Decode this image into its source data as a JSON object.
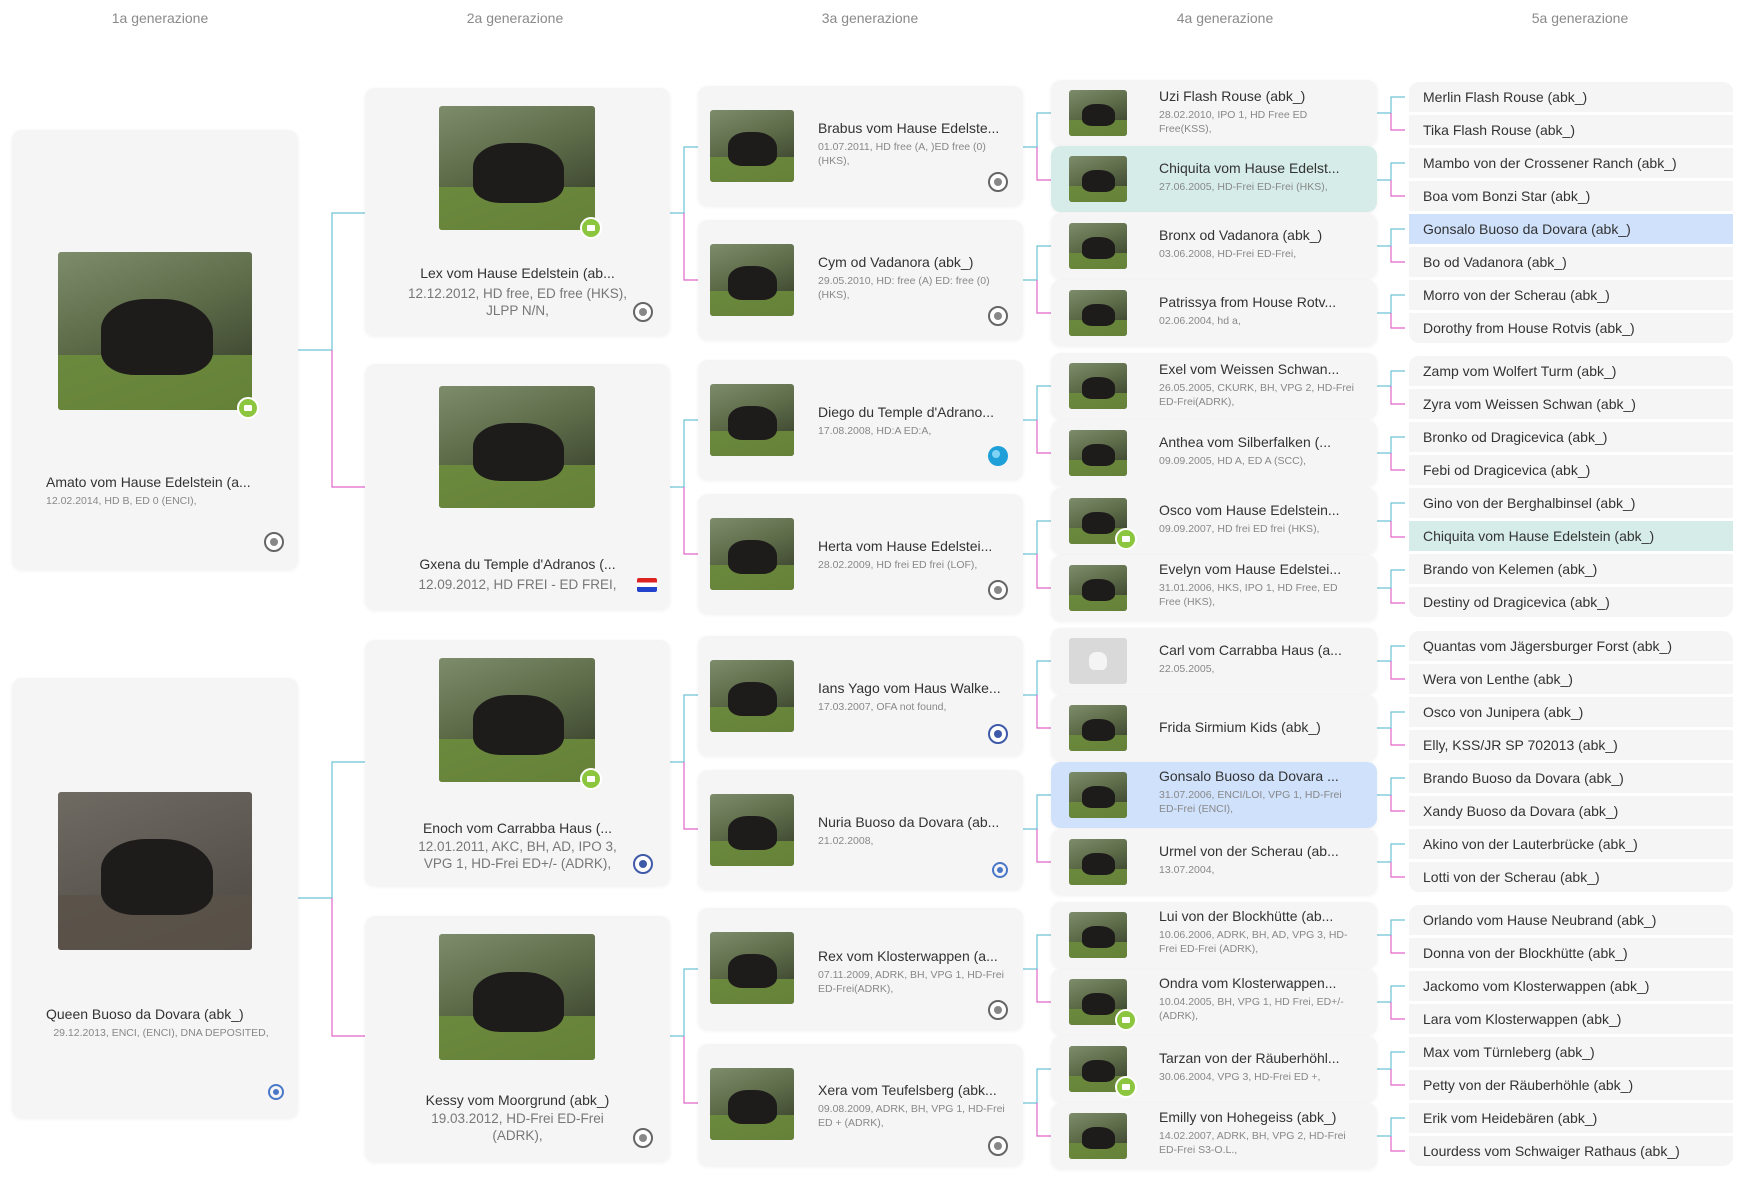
{
  "generations": [
    "1a generazione",
    "2a generazione",
    "3a generazione",
    "4a generazione",
    "5a generazione"
  ],
  "gen1": [
    {
      "name": "Amato vom Hause Edelstein (a...",
      "info": "12.02.2014, HD B, ED 0 (ENCI),"
    },
    {
      "name": "Queen Buoso da Dovara (abk_)",
      "info": "29.12.2013, ENCI, (ENCI), DNA DEPOSITED,"
    }
  ],
  "gen2": [
    {
      "name": "Lex vom Hause Edelstein (ab...",
      "info": "12.12.2012, HD free, ED free (HKS), JLPP N/N,"
    },
    {
      "name": "Gxena du Temple d'Adranos (...",
      "info": "12.09.2012, HD FREI - ED FREI,"
    },
    {
      "name": "Enoch vom Carrabba Haus (...",
      "info": "12.01.2011, AKC, BH, AD, IPO 3, VPG 1, HD-Frei ED+/- (ADRK),"
    },
    {
      "name": "Kessy vom Moorgrund (abk_)",
      "info": "19.03.2012, HD-Frei ED-Frei (ADRK),"
    }
  ],
  "gen3": [
    {
      "name": "Brabus vom Hause Edelste...",
      "info": "01.07.2011, HD free (A, )ED free (0) (HKS),"
    },
    {
      "name": "Cym od Vadanora (abk_)",
      "info": "29.05.2010, HD: free (A) ED: free (0) (HKS),"
    },
    {
      "name": "Diego du Temple d'Adrano...",
      "info": "17.08.2008, HD:A ED:A,"
    },
    {
      "name": "Herta vom Hause Edelstei...",
      "info": "28.02.2009, HD frei ED frei (LOF),"
    },
    {
      "name": "Ians Yago vom Haus Walke...",
      "info": "17.03.2007, OFA not found,"
    },
    {
      "name": "Nuria Buoso da Dovara (ab...",
      "info": "21.02.2008,"
    },
    {
      "name": "Rex vom Klosterwappen (a...",
      "info": "07.11.2009, ADRK, BH, VPG 1, HD-Frei ED-Frei(ADRK),"
    },
    {
      "name": "Xera vom Teufelsberg (abk...",
      "info": "09.08.2009, ADRK, BH, VPG 1, HD-Frei ED + (ADRK),"
    }
  ],
  "gen4": [
    {
      "name": "Uzi Flash Rouse (abk_)",
      "info": "28.02.2010, IPO 1, HD Free ED Free(KSS),"
    },
    {
      "name": "Chiquita vom Hause Edelst...",
      "info": "27.06.2005, HD-Frei ED-Frei (HKS),"
    },
    {
      "name": "Bronx od Vadanora (abk_)",
      "info": "03.06.2008, HD-Frei ED-Frei,"
    },
    {
      "name": "Patrissya from House Rotv...",
      "info": "02.06.2004, hd a,"
    },
    {
      "name": "Exel vom Weissen Schwan...",
      "info": "26.05.2005, CKURK, BH, VPG 2, HD-Frei ED-Frei(ADRK),"
    },
    {
      "name": "Anthea vom Silberfalken (...",
      "info": "09.09.2005, HD A, ED A (SCC),"
    },
    {
      "name": "Osco vom Hause Edelstein...",
      "info": "09.09.2007, HD frei ED frei (HKS),"
    },
    {
      "name": "Evelyn vom Hause Edelstei...",
      "info": "31.01.2006, HKS, IPO 1, HD Free, ED Free (HKS),"
    },
    {
      "name": "Carl vom Carrabba Haus (a...",
      "info": "22.05.2005,"
    },
    {
      "name": "Frida Sirmium Kids (abk_)",
      "info": ""
    },
    {
      "name": "Gonsalo Buoso da Dovara ...",
      "info": "31.07.2006, ENCI/LOI, VPG 1, HD-Frei ED-Frei (ENCI),"
    },
    {
      "name": "Urmel von der Scherau (ab...",
      "info": "13.07.2004,"
    },
    {
      "name": "Lui von der Blockhütte (ab...",
      "info": "10.06.2006, ADRK, BH, AD, VPG 3, HD-Frei ED-Frei (ADRK),"
    },
    {
      "name": "Ondra vom Klosterwappen...",
      "info": "10.04.2005, BH, VPG 1, HD Frei, ED+/- (ADRK),"
    },
    {
      "name": "Tarzan von der Räuberhöhl...",
      "info": "30.06.2004, VPG 3, HD-Frei ED +,"
    },
    {
      "name": "Emilly von Hohegeiss (abk_)",
      "info": "14.02.2007, ADRK, BH, VPG 2, HD-Frei ED-Frei S3-O.L.,"
    }
  ],
  "gen5": [
    "Merlin Flash Rouse (abk_)",
    "Tika Flash Rouse (abk_)",
    "Mambo von der Crossener Ranch (abk_)",
    "Boa vom Bonzi Star (abk_)",
    "Gonsalo Buoso da Dovara (abk_)",
    "Bo od Vadanora (abk_)",
    "Morro von der Scherau (abk_)",
    "Dorothy from House Rotvis (abk_)",
    "Zamp vom Wolfert Turm (abk_)",
    "Zyra vom Weissen Schwan (abk_)",
    "Bronko od Dragicevica (abk_)",
    "Febi od Dragicevica (abk_)",
    "Gino von der Berghalbinsel (abk_)",
    "Chiquita vom Hause Edelstein (abk_)",
    "Brando von Kelemen (abk_)",
    "Destiny od Dragicevica (abk_)",
    "Quantas vom Jägersburger Forst (abk_)",
    "Wera von Lenthe (abk_)",
    "Osco von Junipera (abk_)",
    "Elly, KSS/JR SP 702013 (abk_)",
    "Brando Buoso da Dovara (abk_)",
    "Xandy Buoso da Dovara (abk_)",
    "Akino von der Lauterbrücke (abk_)",
    "Lotti von der Scherau (abk_)",
    "Orlando vom Hause Neubrand (abk_)",
    "Donna von der Blockhütte (abk_)",
    "Jackomo vom Klosterwappen (abk_)",
    "Lara vom Klosterwappen (abk_)",
    "Max vom Türnleberg (abk_)",
    "Petty von der Räuberhöhle (abk_)",
    "Erik vom Heidebären (abk_)",
    "Lourdess vom Schwaiger Rathaus (abk_)"
  ],
  "colors": {
    "sire_line": "#6cc3d5",
    "dam_line": "#e066c8",
    "highlight_blue": "#cfe1fb",
    "highlight_teal": "#d6ece8",
    "video_badge": "#8cc63f"
  }
}
